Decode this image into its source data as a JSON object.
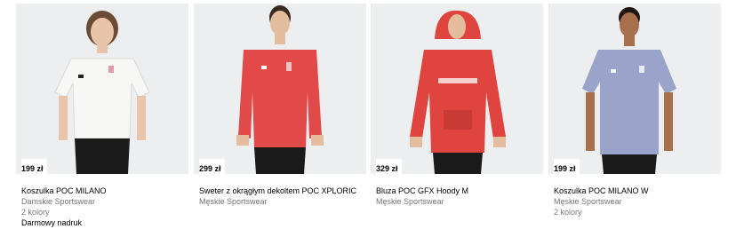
{
  "products": [
    {
      "price": "199 zł",
      "name": "Koszulka POC MILANO",
      "category": "Damskie Sportswear",
      "colors": "2 kolory",
      "note": "Darmowy nadruk",
      "shirt_color": "#f7f7f5",
      "pants_color": "#1a1a1a"
    },
    {
      "price": "299 zł",
      "name": "Sweter z okrągłym dekoltem POC XPLORIC",
      "category": "Męskie Sportswear",
      "colors": "",
      "note": "",
      "shirt_color": "#e24a4a",
      "pants_color": "#1a1a1a"
    },
    {
      "price": "329 zł",
      "name": "Bluza POC GFX Hoody M",
      "category": "Męskie Sportswear",
      "colors": "",
      "note": "",
      "shirt_color": "#e0443e",
      "pants_color": "#1a1a1a"
    },
    {
      "price": "199 zł",
      "name": "Koszulka POC MILANO W",
      "category": "Męskie Sportswear",
      "colors": "2 kolory",
      "note": "",
      "shirt_color": "#9aa3c9",
      "pants_color": "#1a1a1a"
    }
  ]
}
